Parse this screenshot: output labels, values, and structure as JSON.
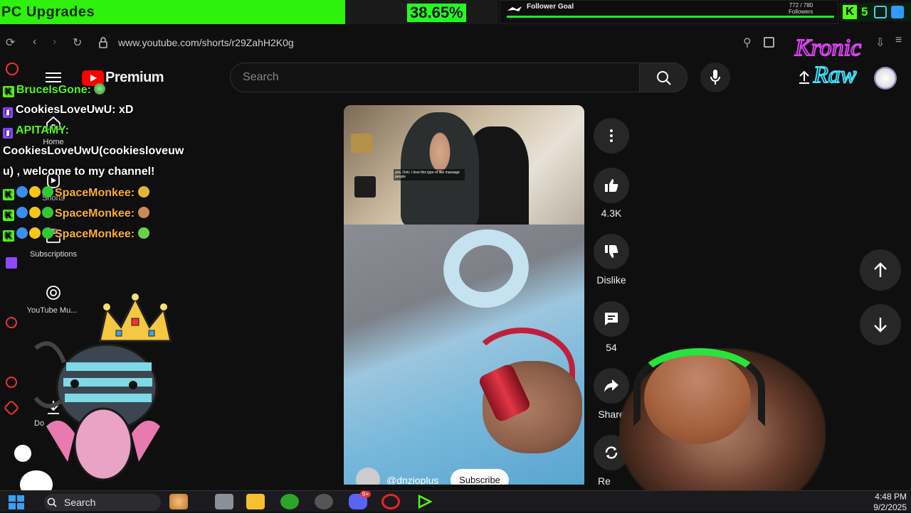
{
  "goal": {
    "title": "PC Upgrades",
    "percent_text": "38.65%",
    "progress": 0.3865
  },
  "follower_goal": {
    "label": "Follower Goal",
    "count": "772 / 780",
    "unit": "Followers"
  },
  "kick_badge": {
    "count": "5"
  },
  "browser": {
    "url": "www.youtube.com/shorts/r29ZahH2K0g"
  },
  "youtube": {
    "logo_text": "Premium",
    "search_placeholder": "Search",
    "sidebar": [
      {
        "label": "Home",
        "icon": "home-icon"
      },
      {
        "label": "Shorts",
        "icon": "shorts-icon"
      },
      {
        "label": "Subscriptions",
        "icon": "subscriptions-icon"
      },
      {
        "label": "YouTube Mu...",
        "icon": "youtube-music-icon"
      },
      {
        "label": "Do",
        "icon": "download-icon"
      }
    ],
    "video": {
      "caption": "yes, Ooh, I love this type of like massage people",
      "channel": "@dnzioplus",
      "subscribe_label": "Subscribe",
      "likes": "4.3K",
      "dislike_label": "Dislike",
      "comments": "54",
      "share_label": "Share",
      "remix_label": "Re"
    }
  },
  "chat": [
    {
      "name": "BruceIsGone:",
      "text": "",
      "platform": "kick",
      "name_color": "#53fc18"
    },
    {
      "name": "CookiesLoveUwU:",
      "text": "xD",
      "platform": "twitch",
      "name_color": "#ffffff"
    },
    {
      "name": "APITAMY:",
      "text": "",
      "platform": "twitch",
      "name_color": "#53fc18"
    },
    {
      "name": "",
      "text": "CookiesLoveUwU(cookiesloveuw",
      "platform": "",
      "name_color": "#ffffff"
    },
    {
      "name": "",
      "text": "u) , welcome to my channel!",
      "platform": "",
      "name_color": "#ffffff"
    },
    {
      "name": "SpaceMonkee:",
      "text": "",
      "platform": "kick",
      "name_color": "#ffb12a"
    },
    {
      "name": "SpaceMonkee:",
      "text": "",
      "platform": "kick",
      "name_color": "#ffb12a"
    },
    {
      "name": "SpaceMonkee:",
      "text": "",
      "platform": "kick",
      "name_color": "#ffb12a"
    }
  ],
  "taskbar": {
    "search_label": "Search",
    "time": "4:48 PM",
    "date": "9/2/2025",
    "discord_badge": "9+"
  },
  "colors": {
    "kick_green": "#53fc18",
    "youtube_red": "#ff0000",
    "twitch_purple": "#9146ff"
  }
}
